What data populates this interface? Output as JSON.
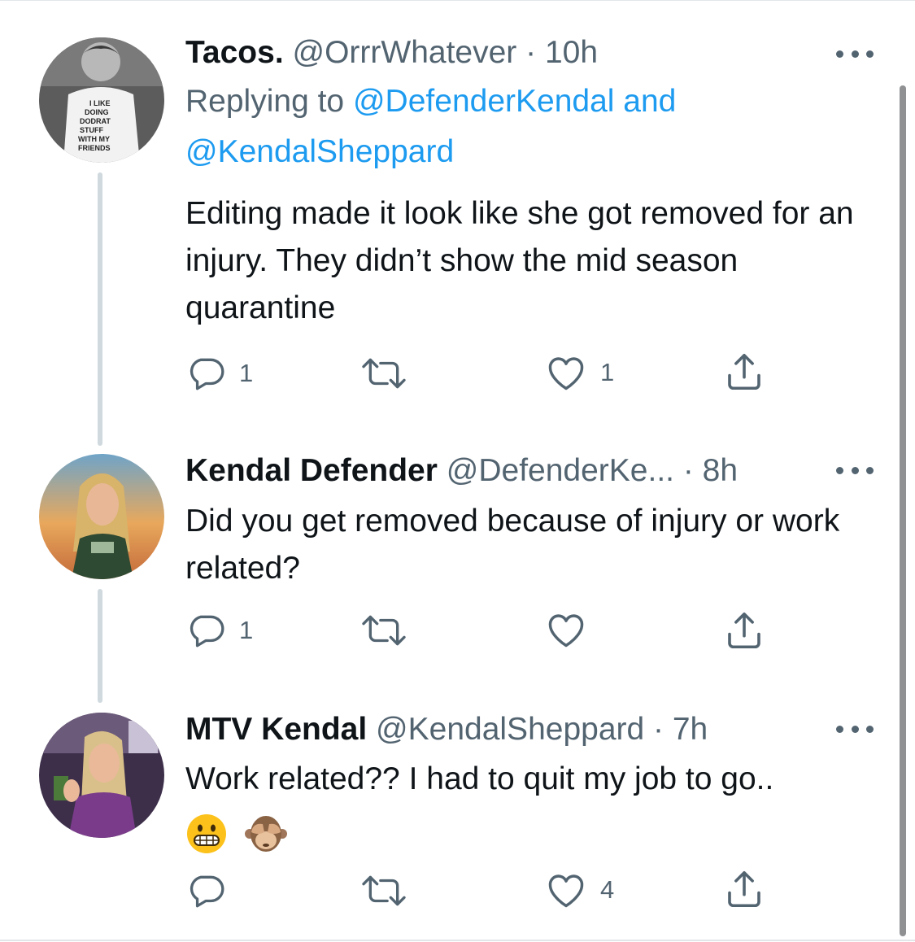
{
  "tweets": [
    {
      "name": "Tacos.",
      "handle": "@OrrrWhatever",
      "time": "· 10h",
      "reply_prefix": "Replying to",
      "reply_link1": "@DefenderKendal",
      "reply_and": "and",
      "reply_link2": "@KendalSheppard",
      "text": "Editing made it look like she got removed for an injury. They didn’t show the mid season quarantine",
      "reply_count": "1",
      "retweet_count": "",
      "like_count": "1",
      "avatar_text": [
        "I LIKE",
        "DOING",
        "DODRAT",
        "STUFF",
        "WITH MY",
        "FRIENDS"
      ]
    },
    {
      "name": "Kendal Defender",
      "handle": "@DefenderKe...",
      "time": "· 8h",
      "text": "Did you get removed because of injury or work related?",
      "reply_count": "1",
      "retweet_count": "",
      "like_count": ""
    },
    {
      "name": "MTV Kendal",
      "handle": "@KendalSheppard",
      "time": "· 7h",
      "text": "Work related?? I had to quit my job to go..",
      "emojis": [
        "grimacing-face",
        "see-no-evil-monkey"
      ],
      "reply_count": "",
      "retweet_count": "",
      "like_count": "4"
    }
  ],
  "icons": [
    "reply-icon",
    "retweet-icon",
    "like-icon",
    "share-icon",
    "more-icon"
  ],
  "colors": {
    "link": "#1d9bf0",
    "secondary_text": "#536471",
    "primary_text": "#0f1419",
    "thread_line": "#cfd9de"
  }
}
